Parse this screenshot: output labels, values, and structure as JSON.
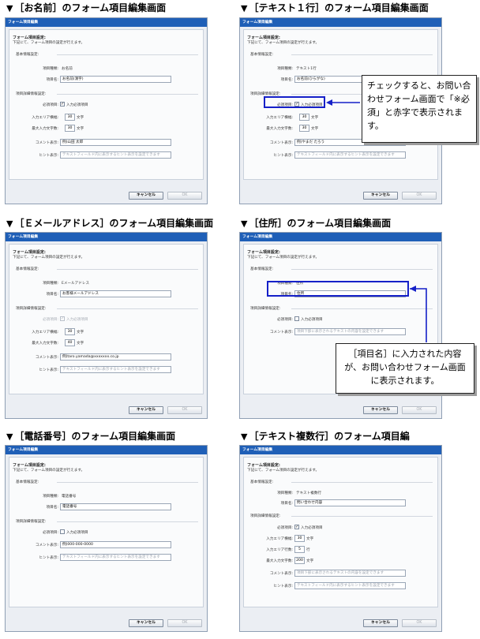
{
  "common": {
    "window_title": "フォーム項目編集",
    "dialog_title": "フォーム項目設定:",
    "dialog_subtitle": "下記にて、フォーム項目の設定が行えます。",
    "basic_section": "基本情報設定:",
    "detail_section": "項目詳細情報設定:",
    "type_label": "項目種類:",
    "name_label": "項目名:",
    "required_label": "必須項目:",
    "required_checkbox": "入力必須項目",
    "width_label": "入力エリア横幅:",
    "rows_label": "入力エリア行数:",
    "maxlen_label": "最大入力文字数:",
    "unit_chars": "文字",
    "unit_rows": "行",
    "comment_label": "コメント表示:",
    "hint_label": "ヒント表示:",
    "hint_placeholder": "テキストフィールド内に表示するヒント表示を設定できます",
    "comment_placeholder": "項目下部に表示されるテキストの内容を設定できます",
    "cancel_button": "キャンセル",
    "ok_button": "OK",
    "check_mark": "✓"
  },
  "panels": [
    {
      "heading": "［お名前］のフォーム項目編集画面",
      "type_value": "お名前",
      "name_value": "お名前(漢字)",
      "width_value": "30",
      "maxlen_value": "30",
      "comment_value": "例)山田 太郎"
    },
    {
      "heading": "［テキスト１行］のフォーム項目編集画面",
      "type_value": "テキスト1行",
      "name_value": "お名前(ひらがな)",
      "width_value": "30",
      "maxlen_value": "30",
      "comment_value": "例)やまだ たろう"
    },
    {
      "heading": "［Ｅメールアドレス］のフォーム項目編集画面",
      "type_value": "Eメールアドレス",
      "name_value": "お客様メールアドレス",
      "width_value": "30",
      "maxlen_value": "40",
      "comment_value": "例)taro.yamada@xxxxxxx.co.jp"
    },
    {
      "heading": "［住所］のフォーム項目編集画面",
      "type_value": "住所",
      "name_value": "住所"
    },
    {
      "heading": "［電話番号］のフォーム項目編集画面",
      "type_value": "電話番号",
      "name_value": "電話番号",
      "comment_value": "例)000-000-0000"
    },
    {
      "heading": "［テキスト複数行］のフォーム項目編",
      "type_value": "テキスト複数行",
      "name_value": "問い合わせ内容",
      "width_value": "30",
      "rows_value": "5",
      "maxlen_value": "200"
    }
  ],
  "callouts": {
    "required": "チェックすると、お問い合わせフォーム画面で「※必須」と赤字で表示されます。",
    "name": "［項目名］に入力された内容が、お問い合わせフォーム画面に表示されます。"
  }
}
